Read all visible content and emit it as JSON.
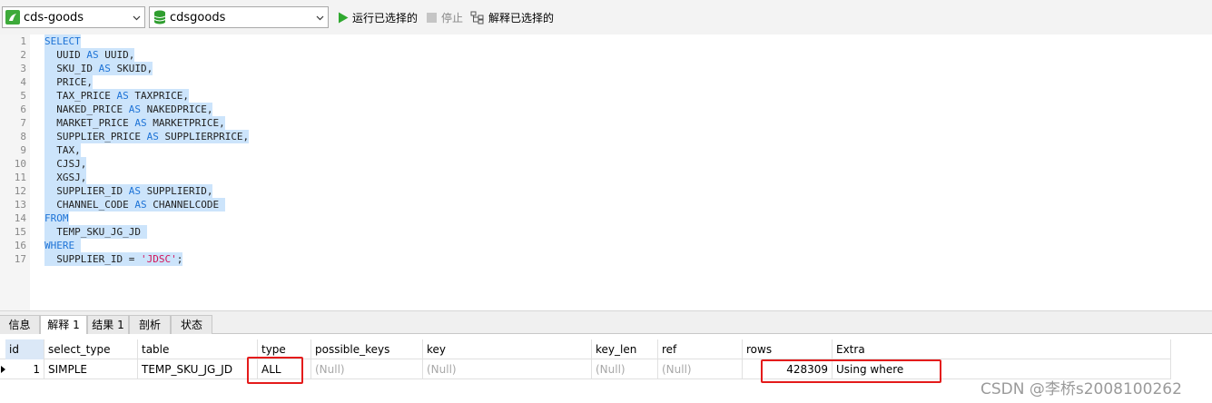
{
  "toolbar": {
    "connection": "cds-goods",
    "database": "cdsgoods",
    "run_selected": "运行已选择的",
    "stop": "停止",
    "explain_selected": "解释已选择的"
  },
  "editor": {
    "line_numbers": [
      "1",
      "2",
      "3",
      "4",
      "5",
      "6",
      "7",
      "8",
      "9",
      "10",
      "11",
      "12",
      "13",
      "14",
      "15",
      "16",
      "17"
    ]
  },
  "tabs": [
    "信息",
    "解释 1",
    "结果 1",
    "剖析",
    "状态"
  ],
  "result": {
    "columns": [
      "id",
      "select_type",
      "table",
      "type",
      "possible_keys",
      "key",
      "key_len",
      "ref",
      "rows",
      "Extra"
    ],
    "row": [
      "1",
      "SIMPLE",
      "TEMP_SKU_JG_JD",
      "ALL",
      "(Null)",
      "(Null)",
      "(Null)",
      "(Null)",
      "428309",
      "Using where"
    ]
  },
  "watermark": "CSDN @李桥s2008100262",
  "colors": {
    "keyword": "#1e73d6",
    "string": "#d4145a",
    "selection": "#cce4fb",
    "highlight_box": "#e41b1b",
    "run_icon": "#2ea82e"
  }
}
